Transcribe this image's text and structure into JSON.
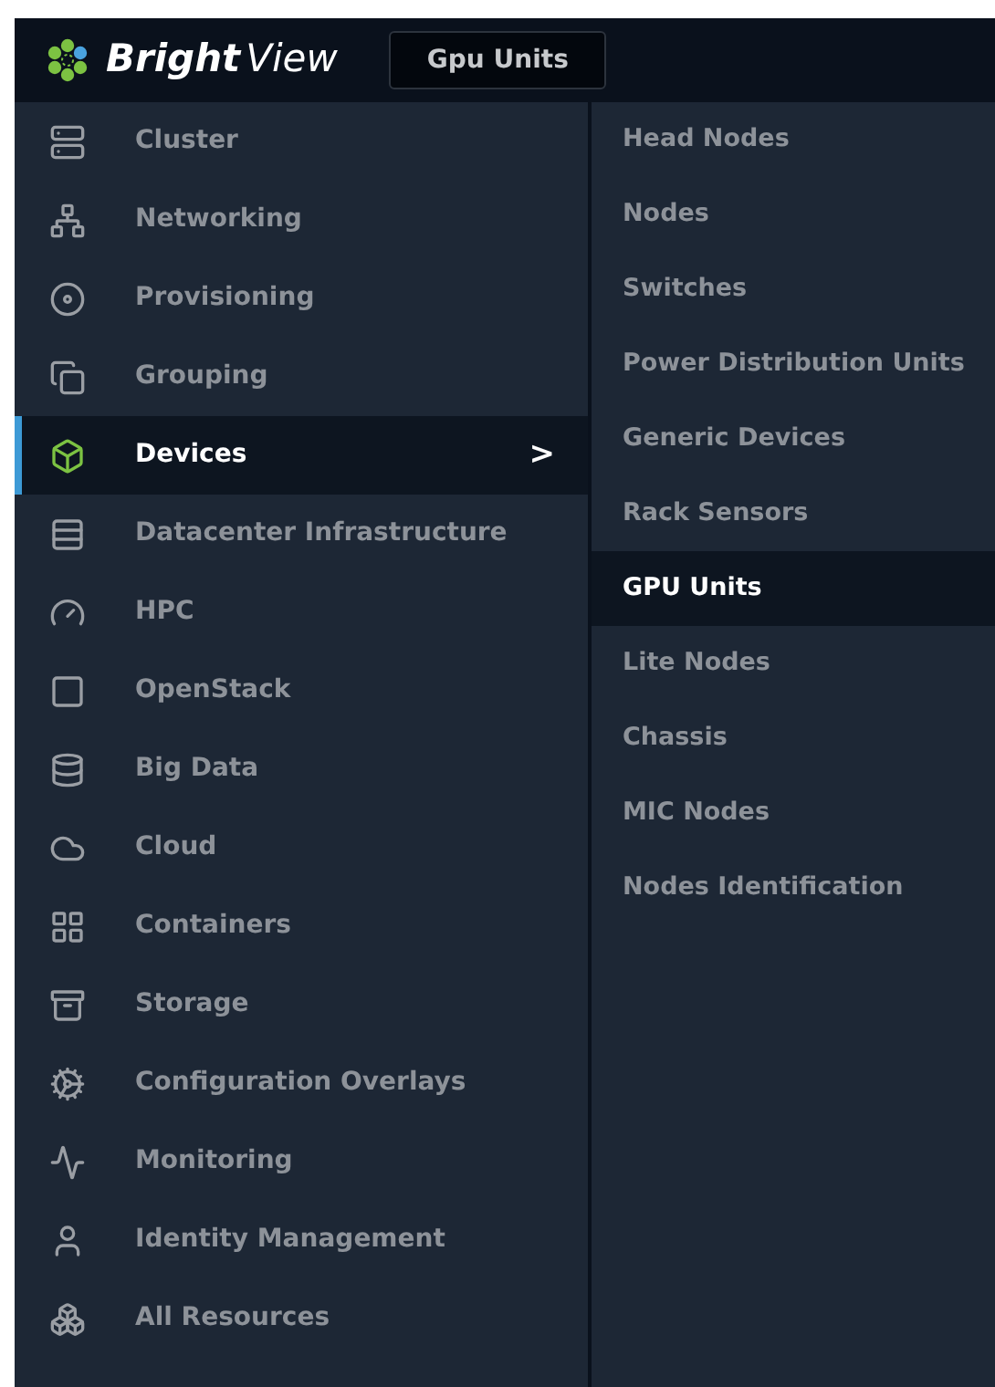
{
  "header": {
    "logo_bold": "Bright",
    "logo_light": "View",
    "context_button": "Gpu Units"
  },
  "sidebar": {
    "items": [
      {
        "label": "Cluster",
        "selected": false
      },
      {
        "label": "Networking",
        "selected": false
      },
      {
        "label": "Provisioning",
        "selected": false
      },
      {
        "label": "Grouping",
        "selected": false
      },
      {
        "label": "Devices",
        "selected": true,
        "chevron": ">"
      },
      {
        "label": "Datacenter Infrastructure",
        "selected": false
      },
      {
        "label": "HPC",
        "selected": false
      },
      {
        "label": "OpenStack",
        "selected": false
      },
      {
        "label": "Big Data",
        "selected": false
      },
      {
        "label": "Cloud",
        "selected": false
      },
      {
        "label": "Containers",
        "selected": false
      },
      {
        "label": "Storage",
        "selected": false
      },
      {
        "label": "Configuration Overlays",
        "selected": false
      },
      {
        "label": "Monitoring",
        "selected": false
      },
      {
        "label": "Identity Management",
        "selected": false
      },
      {
        "label": "All Resources",
        "selected": false
      }
    ]
  },
  "submenu": {
    "items": [
      {
        "label": "Head Nodes",
        "selected": false
      },
      {
        "label": "Nodes",
        "selected": false
      },
      {
        "label": "Switches",
        "selected": false
      },
      {
        "label": "Power Distribution Units",
        "selected": false
      },
      {
        "label": "Generic Devices",
        "selected": false
      },
      {
        "label": "Rack Sensors",
        "selected": false
      },
      {
        "label": "GPU Units",
        "selected": true
      },
      {
        "label": "Lite Nodes",
        "selected": false
      },
      {
        "label": "Chassis",
        "selected": false
      },
      {
        "label": "MIC Nodes",
        "selected": false
      },
      {
        "label": "Nodes Identification",
        "selected": false
      }
    ]
  }
}
